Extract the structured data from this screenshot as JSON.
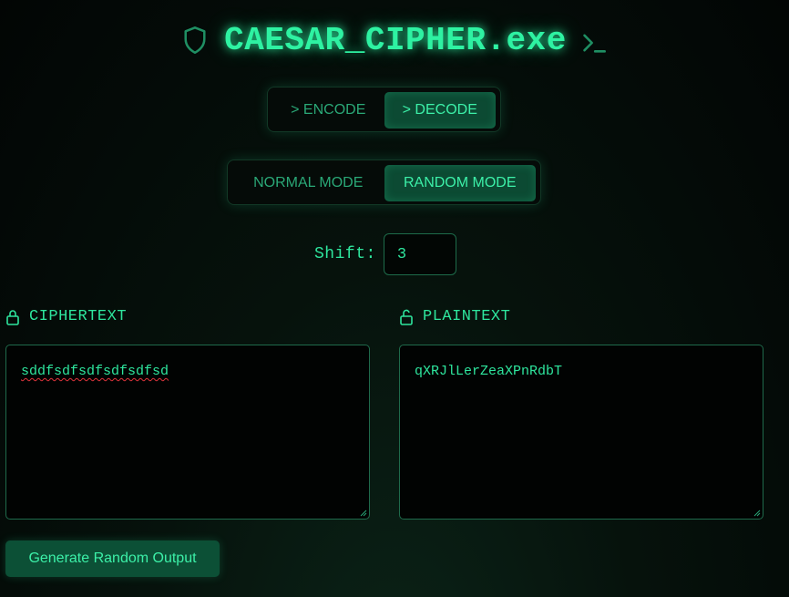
{
  "header": {
    "title": "CAESAR_CIPHER.exe",
    "left_icon": "shield-icon",
    "right_icon": "terminal-prompt-icon"
  },
  "operation_toggle": {
    "encode_label": "> ENCODE",
    "decode_label": "> DECODE",
    "selected": "decode"
  },
  "mode_toggle": {
    "normal_label": "NORMAL MODE",
    "random_label": "RANDOM MODE",
    "selected": "random"
  },
  "shift": {
    "label": "Shift:",
    "value": "3"
  },
  "ciphertext": {
    "label": "CIPHERTEXT",
    "icon": "lock-icon",
    "value": "sddfsdfsdfsdfsdfsd"
  },
  "plaintext": {
    "label": "PLAINTEXT",
    "icon": "unlock-icon",
    "value": "qXRJlLerZeaXPnRdbT"
  },
  "generate_button": {
    "label": "Generate Random Output"
  },
  "colors": {
    "accent": "#2ee59d",
    "background": "#040a07",
    "active_bg": "#0c4a33",
    "spellcheck": "#e0343c"
  }
}
